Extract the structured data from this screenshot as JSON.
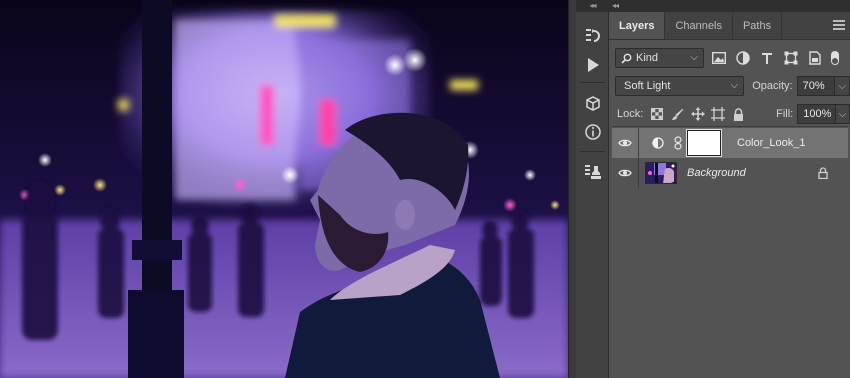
{
  "panel": {
    "tabs": [
      "Layers",
      "Channels",
      "Paths"
    ],
    "active_tab": "Layers",
    "filter": {
      "kind_label": "Kind"
    },
    "blend_mode": "Soft Light",
    "opacity_label": "Opacity:",
    "opacity_value": "70%",
    "lock_label": "Lock:",
    "fill_label": "Fill:",
    "fill_value": "100%",
    "layers": [
      {
        "name": "Color_Look_1",
        "selected": true,
        "type": "adjustment"
      },
      {
        "name": "Background",
        "selected": false,
        "type": "image",
        "locked": true
      }
    ]
  },
  "colors": {
    "panel_bg": "#535353",
    "tab_bar_bg": "#424242",
    "selected_layer_bg": "#737373",
    "photo_tint": "#5b2fbf"
  },
  "toolstrip_icons": [
    "history-icon",
    "play-actions-icon",
    "cube-3d-icon",
    "info-icon",
    "clone-source-icon"
  ]
}
